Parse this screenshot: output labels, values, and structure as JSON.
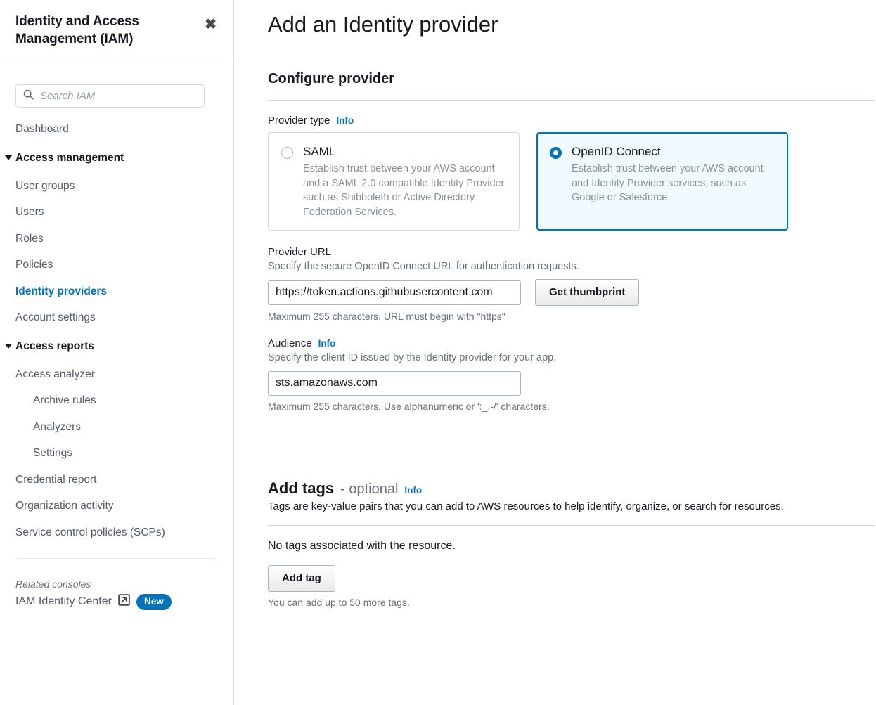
{
  "sidebar": {
    "title": "Identity and Access Management (IAM)",
    "close_icon": "close-icon",
    "search": {
      "placeholder": "Search IAM",
      "value": "",
      "icon": "search-icon"
    },
    "dashboard_label": "Dashboard",
    "groups": [
      {
        "label": "Access management",
        "items": [
          {
            "label": "User groups",
            "active": false,
            "indent": false
          },
          {
            "label": "Users",
            "active": false,
            "indent": false
          },
          {
            "label": "Roles",
            "active": false,
            "indent": false
          },
          {
            "label": "Policies",
            "active": false,
            "indent": false
          },
          {
            "label": "Identity providers",
            "active": true,
            "indent": false
          },
          {
            "label": "Account settings",
            "active": false,
            "indent": false
          }
        ]
      },
      {
        "label": "Access reports",
        "items": [
          {
            "label": "Access analyzer",
            "active": false,
            "indent": false
          },
          {
            "label": "Archive rules",
            "active": false,
            "indent": true
          },
          {
            "label": "Analyzers",
            "active": false,
            "indent": true
          },
          {
            "label": "Settings",
            "active": false,
            "indent": true
          },
          {
            "label": "Credential report",
            "active": false,
            "indent": false
          },
          {
            "label": "Organization activity",
            "active": false,
            "indent": false
          },
          {
            "label": "Service control policies (SCPs)",
            "active": false,
            "indent": false
          }
        ]
      }
    ],
    "related_consoles_label": "Related consoles",
    "related_console_link": "IAM Identity Center",
    "external_link_icon": "external-link-icon",
    "new_badge": "New"
  },
  "main": {
    "page_title": "Add an Identity provider",
    "section_title": "Configure provider",
    "provider_type": {
      "label": "Provider type",
      "info_label": "Info",
      "options": [
        {
          "id": "saml",
          "title": "SAML",
          "description": "Establish trust between your AWS account and a SAML 2.0 compatible Identity Provider such as Shibboleth or Active Directory Federation Services.",
          "selected": false
        },
        {
          "id": "oidc",
          "title": "OpenID Connect",
          "description": "Establish trust between your AWS account and Identity Provider services, such as Google or Salesforce.",
          "selected": true
        }
      ]
    },
    "provider_url": {
      "label": "Provider URL",
      "description": "Specify the secure OpenID Connect URL for authentication requests.",
      "value": "https://token.actions.githubusercontent.com",
      "placeholder": "",
      "hint": "Maximum 255 characters. URL must begin with \"https\"",
      "button_label": "Get thumbprint"
    },
    "audience": {
      "label": "Audience",
      "info_label": "Info",
      "description": "Specify the client ID issued by the Identity provider for your app.",
      "value": "sts.amazonaws.com",
      "placeholder": "",
      "hint": "Maximum 255 characters. Use alphanumeric or ':_.-/' characters."
    },
    "tags": {
      "title": "Add tags",
      "optional_label": "- optional",
      "info_label": "Info",
      "description": "Tags are key-value pairs that you can add to AWS resources to help identify, organize, or search for resources.",
      "empty_message": "No tags associated with the resource.",
      "add_button_label": "Add tag",
      "limit_hint": "You can add up to 50 more tags."
    }
  },
  "colors": {
    "accent_blue": "#0073bb",
    "selected_card_bg": "#f1faff",
    "text_primary": "#16191f",
    "text_secondary": "#687078",
    "border": "#d5dbdb"
  }
}
